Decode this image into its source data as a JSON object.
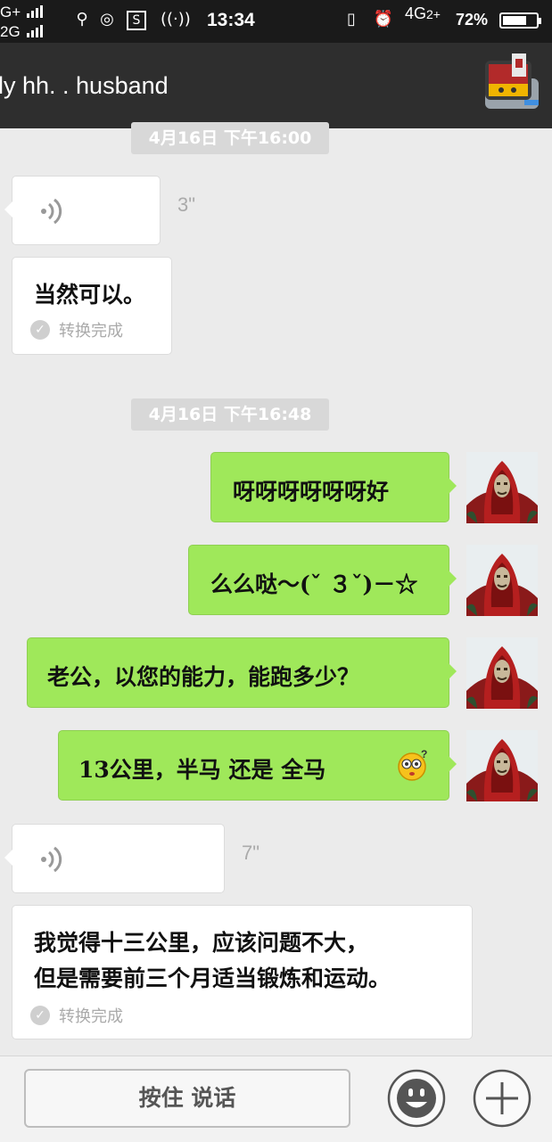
{
  "status_bar": {
    "network_top": "G+",
    "network_bottom": "2G",
    "time": "13:34",
    "network_type": "4G",
    "network_sub": "2+",
    "battery": "72%",
    "battery_level": 0.72
  },
  "header": {
    "title": "ly  hh. . husband"
  },
  "messages": [
    {
      "type": "time",
      "text": "4月16日 下午16:00"
    },
    {
      "type": "voice",
      "side": "left",
      "duration": "3\""
    },
    {
      "type": "text",
      "side": "left",
      "text": "当然可以。",
      "status": "转换完成"
    },
    {
      "type": "time",
      "text": "4月16日 下午16:48"
    },
    {
      "type": "text",
      "side": "right",
      "text": "呀呀呀呀呀呀好"
    },
    {
      "type": "text",
      "side": "right",
      "text": "么么哒～(ˇ ３ˇ)－☆"
    },
    {
      "type": "text",
      "side": "right",
      "text": "老公，以您的能力，能跑多少？"
    },
    {
      "type": "text",
      "side": "right",
      "text": "13公里，半马 还是  全马"
    },
    {
      "type": "voice",
      "side": "left",
      "duration": "7\""
    },
    {
      "type": "text",
      "side": "left",
      "lines": [
        "我觉得十三公里，应该问题不大，",
        "但是需要前三个月适当锻炼和运动。"
      ],
      "status": "转换完成"
    }
  ],
  "bottom_bar": {
    "hold_to_talk": "按住 说话"
  },
  "colors": {
    "sent_bubble": "#9fe85a",
    "received_bubble": "#ffffff",
    "header_bg": "#2e2e2e"
  }
}
